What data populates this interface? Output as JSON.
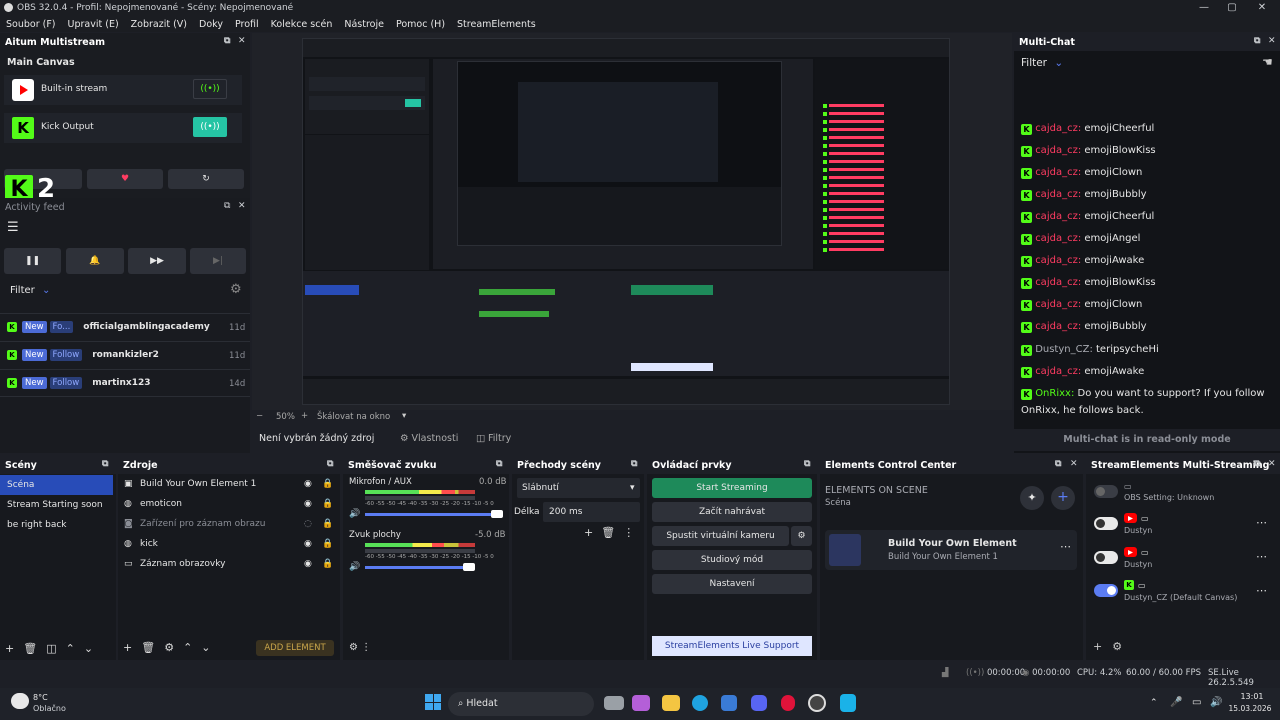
{
  "window": {
    "title": "OBS 32.0.4 - Profil: Nepojmenované - Scény: Nepojmenované",
    "min": "—",
    "max": "▢",
    "close": "✕"
  },
  "menu": [
    "Soubor (F)",
    "Upravit (E)",
    "Zobrazit (V)",
    "Doky",
    "Profil",
    "Kolekce scén",
    "Nástroje",
    "Pomoc (H)",
    "StreamElements"
  ],
  "aitum": {
    "title": "Aitum Multistream",
    "canvas": "Main Canvas",
    "outputs": [
      {
        "label": "Built-in stream"
      },
      {
        "label": "Kick Output"
      }
    ]
  },
  "overlay_counter": "2",
  "activity": {
    "title": "Activity feed",
    "filter": "Filter",
    "items": [
      {
        "new": "New",
        "type": "Fo...",
        "name": "officialgamblingacademy",
        "age": "11d"
      },
      {
        "new": "New",
        "type": "Follow",
        "name": "romankizler2",
        "age": "11d"
      },
      {
        "new": "New",
        "type": "Follow",
        "name": "martinx123",
        "age": "14d"
      }
    ]
  },
  "preview": {
    "zoom": "50%",
    "scale_label": "Škálovat na okno"
  },
  "source_bar": {
    "none_selected": "Není vybrán žádný zdroj",
    "properties": "Vlastnosti",
    "filters": "Filtry"
  },
  "multichat": {
    "title": "Multi-Chat",
    "filter": "Filter",
    "readonly": "Multi-chat is in read-only mode",
    "messages": [
      {
        "user": "cajda_cz:",
        "text": "emojiCheerful",
        "kind": "kick"
      },
      {
        "user": "cajda_cz:",
        "text": "emojiBlowKiss",
        "kind": "kick"
      },
      {
        "user": "cajda_cz:",
        "text": "emojiClown",
        "kind": "kick"
      },
      {
        "user": "cajda_cz:",
        "text": "emojiBubbly",
        "kind": "kick"
      },
      {
        "user": "cajda_cz:",
        "text": "emojiCheerful",
        "kind": "kick"
      },
      {
        "user": "cajda_cz:",
        "text": "emojiAngel",
        "kind": "kick"
      },
      {
        "user": "cajda_cz:",
        "text": "emojiAwake",
        "kind": "kick"
      },
      {
        "user": "cajda_cz:",
        "text": "emojiBlowKiss",
        "kind": "kick"
      },
      {
        "user": "cajda_cz:",
        "text": "emojiClown",
        "kind": "kick"
      },
      {
        "user": "cajda_cz:",
        "text": "emojiBubbly",
        "kind": "kick"
      },
      {
        "user": "Dustyn_CZ:",
        "text": "teripsycheHi",
        "kind": "kick2"
      },
      {
        "user": "cajda_cz:",
        "text": "emojiAwake",
        "kind": "kick"
      },
      {
        "user": "OnRixx:",
        "text": "Do you want to support? If you follow OnRixx, he follows back.",
        "kind": "kick3"
      }
    ]
  },
  "scenes": {
    "title": "Scény",
    "items": [
      "Scéna",
      "Stream Starting soon",
      "be right back"
    ]
  },
  "sources": {
    "title": "Zdroje",
    "add_element": "ADD ELEMENT",
    "items": [
      {
        "label": "Build Your Own Element 1",
        "icon": "element-icon",
        "dim": false
      },
      {
        "label": "emoticon",
        "icon": "globe-icon",
        "dim": false
      },
      {
        "label": "Zařízení pro záznam obrazu",
        "icon": "camera-icon",
        "dim": true
      },
      {
        "label": "kick",
        "icon": "globe-icon",
        "dim": false
      },
      {
        "label": "Záznam obrazovky",
        "icon": "monitor-icon",
        "dim": false
      }
    ]
  },
  "mixer": {
    "title": "Směšovač zvuku",
    "channels": [
      {
        "name": "Mikrofon / AUX",
        "db": "0.0 dB",
        "level": 0.82
      },
      {
        "name": "Zvuk plochy",
        "db": "-5.0 dB",
        "level": 0.72
      }
    ],
    "scale": "-60 -55 -50 -45 -40 -35 -30 -25 -20 -15 -10 -5 0"
  },
  "transitions": {
    "title": "Přechody scény",
    "type": "Slábnutí",
    "duration_label": "Délka",
    "duration": "200 ms"
  },
  "controls": {
    "title": "Ovládací prvky",
    "start": "Start Streaming",
    "record": "Začít nahrávat",
    "vcam": "Spustit virtuální kameru",
    "studio": "Studiový mód",
    "settings": "Nastavení",
    "support": "StreamElements Live Support"
  },
  "ecc": {
    "title": "Elements Control Center",
    "heading": "ELEMENTS ON SCENE",
    "scene": "Scéna",
    "element_title": "Build Your Own Element",
    "element_sub": "Build Your Own Element 1"
  },
  "semulti": {
    "title": "StreamElements Multi-Streaming",
    "rows": [
      {
        "label": "OBS Setting: Unknown",
        "state": "off"
      },
      {
        "label": "Dustyn",
        "state": "white"
      },
      {
        "label": "Dustyn",
        "state": "white"
      },
      {
        "label": "Dustyn_CZ (Default Canvas)",
        "state": "on"
      }
    ]
  },
  "status": {
    "t1": "00:00:00",
    "t2": "00:00:00",
    "cpu": "CPU: 4.2%",
    "fps": "60.00 / 60.00 FPS",
    "se": "SE.Live 26.2.5.549"
  },
  "taskbar": {
    "temp": "8°C",
    "weather": "Oblačno",
    "search": "Hledat",
    "time": "13:01",
    "date": "15.03.2026"
  }
}
